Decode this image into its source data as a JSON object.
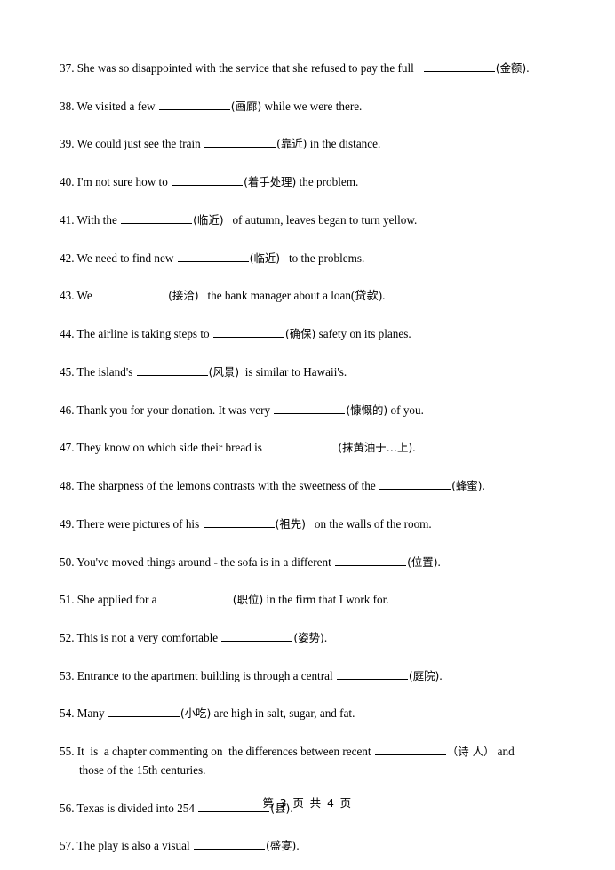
{
  "document": {
    "type": "worksheet",
    "footer": "第 3 页 共 4 页",
    "page_number": 3,
    "total_pages": 4,
    "text_color": "#000000",
    "background_color": "#ffffff"
  },
  "questions": [
    {
      "number": "37.",
      "pre": "She was so disappointed with the service that she refused to pay the full   ",
      "hint": "(金额)",
      "post": ".",
      "blank_width": 80
    },
    {
      "number": "38.",
      "pre": "We visited a few ",
      "hint": "(画廊)",
      "post": " while we were there.",
      "blank_width": 80
    },
    {
      "number": "39.",
      "pre": "We could just see the train ",
      "hint": "(靠近)",
      "post": " in the distance.",
      "blank_width": 80
    },
    {
      "number": "40.",
      "pre": "I'm not sure how to ",
      "hint": "(着手处理)",
      "post": " the problem.",
      "blank_width": 80
    },
    {
      "number": "41.",
      "pre": "With the ",
      "hint": "(临近)",
      "post": "   of autumn, leaves began to turn yellow.",
      "blank_width": 80
    },
    {
      "number": "42.",
      "pre": "We need to find new ",
      "hint": "(临近)",
      "post": "   to the problems.",
      "blank_width": 80
    },
    {
      "number": "43.",
      "pre": "We ",
      "hint": "(接洽)",
      "post": "   the bank manager about a loan(贷款).",
      "blank_width": 80
    },
    {
      "number": "44.",
      "pre": "The airline is taking steps to ",
      "hint": "(确保)",
      "post": " safety on its planes.",
      "blank_width": 80
    },
    {
      "number": "45.",
      "pre": "The island's ",
      "hint": "(风景)",
      "post": "  is similar to Hawaii's.",
      "blank_width": 80
    },
    {
      "number": "46.",
      "pre": "Thank you for your donation. It was very ",
      "hint": "(慷慨的)",
      "post": " of you.",
      "blank_width": 80
    },
    {
      "number": "47.",
      "pre": "They know on which side their bread is ",
      "hint": "(抹黄油于…上)",
      "post": ".",
      "blank_width": 80
    },
    {
      "number": "48.",
      "pre": "The sharpness of the lemons contrasts with the sweetness of the ",
      "hint": "(蜂蜜)",
      "post": ".",
      "blank_width": 80
    },
    {
      "number": "49.",
      "pre": "There were pictures of his ",
      "hint": "(祖先)",
      "post": "   on the walls of the room.",
      "blank_width": 80
    },
    {
      "number": "50.",
      "pre": "You've moved things around - the sofa is in a different ",
      "hint": "(位置)",
      "post": ".",
      "blank_width": 80
    },
    {
      "number": "51.",
      "pre": "She applied for a ",
      "hint": "(职位)",
      "post": " in the firm that I work for.",
      "blank_width": 80
    },
    {
      "number": "52.",
      "pre": "This is not a very comfortable ",
      "hint": "(姿势)",
      "post": ".",
      "blank_width": 80
    },
    {
      "number": "53.",
      "pre": "Entrance to the apartment building is through a central ",
      "hint": "(庭院)",
      "post": ".",
      "blank_width": 80
    },
    {
      "number": "54.",
      "pre": "Many ",
      "hint": "(小吃)",
      "post": " are high in salt, sugar, and fat.",
      "blank_width": 80
    },
    {
      "number": "55.",
      "pre": "It  is  a chapter commenting on  the differences between recent ",
      "hint": "（诗 人）",
      "post": " and",
      "line2": "those of the 15th centuries.",
      "blank_width": 80
    },
    {
      "number": "56.",
      "pre": "Texas is divided into 254 ",
      "hint": "(县)",
      "post": ".",
      "blank_width": 80
    },
    {
      "number": "57.",
      "pre": "The play is also a visual ",
      "hint": "(盛宴)",
      "post": ".",
      "blank_width": 80
    }
  ]
}
